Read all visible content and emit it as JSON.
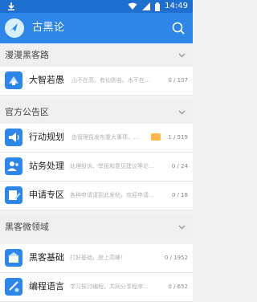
{
  "app": {
    "title": "古黑论"
  },
  "status": {
    "time": "14:49"
  },
  "sections": [
    {
      "label": "漫漫黑客路"
    },
    {
      "label": "官方公告区"
    },
    {
      "label": "黑客微领域"
    }
  ],
  "forums": [
    {
      "name": "大智若愚",
      "desc": "山不在高，有仙则名。水不在…",
      "count": "0 / 107"
    },
    {
      "name": "行动规划",
      "desc": "由管理员发布重大事项、…",
      "count": "1 / 519"
    },
    {
      "name": "站务处理",
      "desc": "处理投诉、举报和意见建议等论…",
      "count": "0 / 24"
    },
    {
      "name": "申请专区",
      "desc": "各种申请请到此发帖，欢迎申请…",
      "count": "0 / 18"
    },
    {
      "name": "黑客基础",
      "desc": "打好基础，登上高峰！",
      "count": "0 / 1952"
    },
    {
      "name": "编程语言",
      "desc": "学习探讨编程，共同分享程序…",
      "count": "0 / 652"
    }
  ],
  "icons": {
    "download": "download-icon",
    "wifi": "wifi-icon",
    "signal": "signal-icon",
    "battery": "battery-icon",
    "search": "search-icon",
    "chevron": "chevron-down-icon",
    "forum": "forum-icon"
  }
}
